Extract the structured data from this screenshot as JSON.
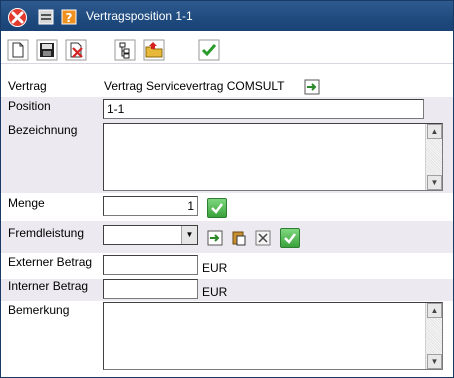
{
  "window": {
    "title": "Vertragsposition 1-1"
  },
  "title_icons": [
    "close-icon",
    "minimize-icon",
    "help-icon"
  ],
  "toolbar": {
    "buttons": [
      "new-document-icon",
      "save-icon",
      "delete-icon",
      "tree-icon",
      "open-folder-icon",
      "confirm-icon"
    ]
  },
  "form": {
    "vertrag": {
      "label": "Vertrag",
      "value": "Vertrag Servicevertrag COMSULT"
    },
    "position": {
      "label": "Position",
      "value": "1-1"
    },
    "bezeichnung": {
      "label": "Bezeichnung",
      "value": ""
    },
    "menge": {
      "label": "Menge",
      "value": "1"
    },
    "fremdleistung": {
      "label": "Fremdleistung",
      "value": ""
    },
    "externer_betrag": {
      "label": "Externer Betrag",
      "value": "",
      "unit": "EUR"
    },
    "interner_betrag": {
      "label": "Interner Betrag",
      "value": "",
      "unit": "EUR"
    },
    "bemerkung": {
      "label": "Bemerkung",
      "value": ""
    }
  },
  "colors": {
    "title_bar": "#1e4a7e",
    "row_shade": "#ece9f0",
    "ok_green": "#3aa23a"
  }
}
